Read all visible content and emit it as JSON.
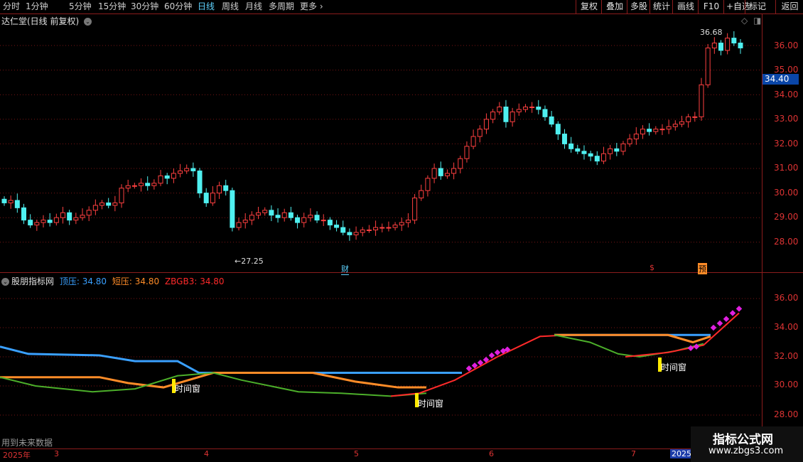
{
  "toolbar": {
    "periods": [
      "分时",
      "1分钟",
      "5分钟",
      "15分钟",
      "30分钟",
      "60分钟",
      "日线",
      "周线",
      "月线",
      "多周期",
      "更多"
    ],
    "active_period": "日线",
    "right_buttons": [
      "复权",
      "叠加",
      "多股",
      "统计",
      "画线",
      "F10",
      "+自选",
      "返回"
    ],
    "more_arrow": "›",
    "tag_button": "标记"
  },
  "main_chart": {
    "title": "达仁堂(日线 前复权)",
    "chevron": "⌄",
    "current_price": "34.40",
    "high_label": "36.68",
    "low_label": "27.25",
    "badges": [
      {
        "text": "财",
        "color": "#5fd3ff"
      },
      {
        "text": "$",
        "color": "#d33"
      },
      {
        "text": "预",
        "color": "#ff8c28"
      }
    ],
    "y_ticks": [
      "36.00",
      "35.00",
      "34.00",
      "33.00",
      "32.00",
      "31.00",
      "30.00",
      "29.00",
      "28.00"
    ]
  },
  "indicator": {
    "name": "股朋指标网",
    "lines": [
      {
        "label": "顶压: 34.80",
        "color": "#3aa0ff"
      },
      {
        "label": "短压: 34.80",
        "color": "#ff8c28"
      },
      {
        "label": "ZBGB3: 34.80",
        "color": "#ff2a2a"
      }
    ],
    "y_ticks": [
      "36.00",
      "34.00",
      "32.00",
      "30.00",
      "28.00"
    ],
    "time_window_label": "时间窗"
  },
  "x_axis": {
    "labels": [
      "2025年",
      "3",
      "4",
      "5",
      "6",
      "7",
      "2025"
    ]
  },
  "footer_note": "用到未来数据",
  "watermark": {
    "line1": "指标公式网",
    "line2": "www.zbgs3.com"
  },
  "colors": {
    "up": "#ff4040",
    "down": "#4ff0f0",
    "grid": "#7a1515",
    "axis": "#8b1c1c"
  }
}
